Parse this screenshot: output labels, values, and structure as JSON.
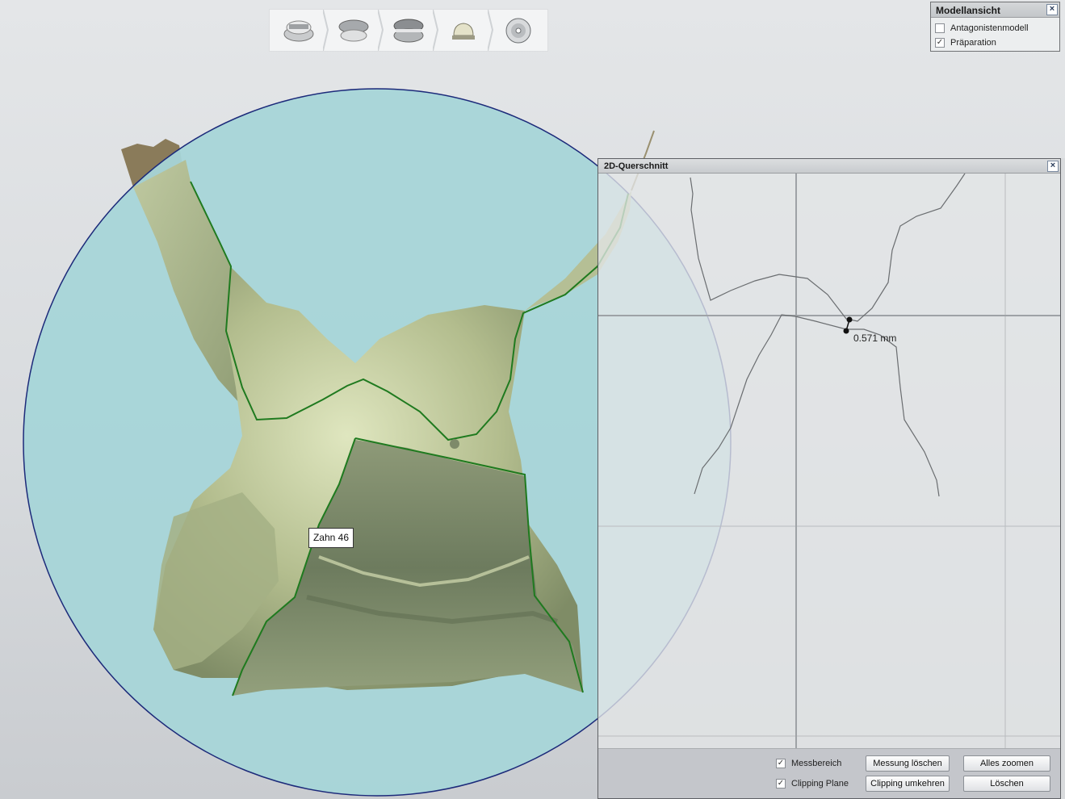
{
  "workflow": {
    "steps": [
      {
        "name": "Modellieren Kiefer",
        "icon": "jaw-scan-icon"
      },
      {
        "name": "Antagonist",
        "icon": "antagonist-scan-icon"
      },
      {
        "name": "Biss",
        "icon": "bite-scan-icon"
      },
      {
        "name": "Design",
        "icon": "crown-design-icon"
      },
      {
        "name": "Ausgabe",
        "icon": "disc-export-icon"
      }
    ]
  },
  "model_view": {
    "title": "Modellansicht",
    "close": "×",
    "options": [
      {
        "label": "Antagonistenmodell",
        "checked": false
      },
      {
        "label": "Präparation",
        "checked": true
      }
    ]
  },
  "tooth_label": "Zahn 46",
  "cross_section": {
    "title": "2D-Querschnitt",
    "close": "×",
    "measurement": "0.571 mm",
    "options": [
      {
        "label": "Messbereich",
        "checked": true
      },
      {
        "label": "Clipping Plane",
        "checked": true
      }
    ],
    "buttons": {
      "delete_measurement": "Messung löschen",
      "zoom_all": "Alles zoomen",
      "invert_clipping": "Clipping umkehren",
      "delete": "Löschen"
    }
  },
  "colors": {
    "sphere": "#a6d5d8",
    "sphere_outline": "#1c2a7a",
    "tooth": "#b9c294",
    "margin_line": "#1f7a1f"
  }
}
